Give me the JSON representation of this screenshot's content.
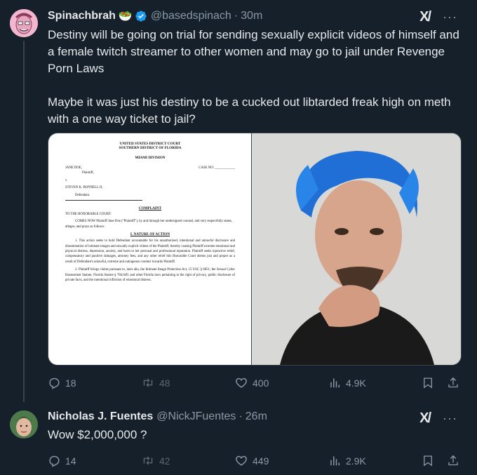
{
  "tweets": [
    {
      "name": "Spinachbrah",
      "emoji": "🥗",
      "handle": "@basedspinach",
      "time": "30m",
      "grok": "X/",
      "more": "···",
      "text": "Destiny will be going on trial for sending sexually explicit videos of himself and a female twitch streamer to other women and may go to jail under Revenge Porn Laws\n\nMaybe it was just his destiny to be a cucked out libtarded freak high on meth with a one way ticket to jail?",
      "replies": "18",
      "reposts": "48",
      "likes": "400",
      "views": "4.9K"
    },
    {
      "name": "Nicholas J. Fuentes",
      "handle": "@NickJFuentes",
      "time": "26m",
      "grok": "X/",
      "more": "···",
      "text": "Wow $2,000,000 ?",
      "replies": "14",
      "reposts": "42",
      "likes": "449",
      "views": "2.9K"
    }
  ],
  "document": {
    "court1": "UNITED STATES DISTRICT COURT",
    "court2": "SOUTHERN DISTRICT OF FLORIDA",
    "division": "MIAMI DIVISION",
    "plaintiff": "JANE DOE,",
    "case_no": "CASE NO: ____________",
    "plaintiff_label": "Plaintiff,",
    "v": "v.",
    "defendant": "STEVEN K. BONNELL II,",
    "defendant_label": "Defendant.",
    "complaint": "COMPLAINT",
    "to_court": "TO THE HONORABLE COURT:",
    "intro": "COMES NOW Plaintiff Jane Doe (\"Plaintiff\"), by and through her undersigned counsel, and very respectfully states, alleges, and prays as follows:",
    "section": "I.   NATURE OF ACTION",
    "p1": "1.   This action seeks to hold Defendant accountable for his unauthorized, intentional and unlawful disclosure and dissemination of intimate images and sexually explicit videos of the Plaintiff, thereby causing Plaintiff extreme emotional and physical distress, depression, anxiety, and harm to her personal and professional reputation. Plaintiff seeks injunctive relief, compensatory and punitive damages, attorney fees, and any other relief this Honorable Court deems just and proper as a result of Defendant's unlawful, extreme and outrageous conduct towards Plaintiff.",
    "p2": "2.   Plaintiff brings claims pursuant to, inter alia, the Intimate Image Protection Act, 15 USC § 6851; the Sexual Cyber Harassment Statute, Florida Statute § 784.049; and other Florida laws pertaining to the right of privacy, public disclosure of private facts, and the intentional infliction of emotional distress."
  },
  "colors": {
    "background": "#15202b",
    "text": "#e7e9ea",
    "muted": "#8b98a5",
    "verified": "#1d9bf0",
    "hair": "#1f6fd6"
  }
}
